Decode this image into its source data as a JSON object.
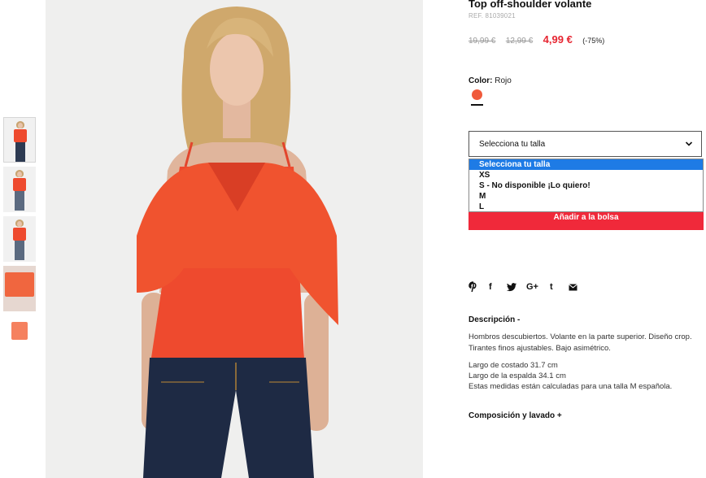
{
  "product": {
    "title": "Top off-shoulder volante",
    "ref": "REF. 81039021",
    "price_original": "19,99 €",
    "price_previous": "12,99 €",
    "price_current": "4,99 €",
    "discount": "(-75%)"
  },
  "color": {
    "label": "Color:",
    "value": "Rojo",
    "swatch_color": "#f05a3b"
  },
  "size": {
    "select_label": "Selecciona tu talla",
    "options": [
      "Selecciona tu talla",
      "XS",
      "S - No disponible ¡Lo quiero!",
      "M",
      "L"
    ]
  },
  "add_to_bag": "Añadir a la bolsa",
  "share_icons": [
    "pinterest-icon",
    "facebook-icon",
    "twitter-icon",
    "google-plus-icon",
    "tumblr-icon",
    "email-icon"
  ],
  "share_glyphs": {
    "facebook": "f",
    "google_plus": "G+",
    "tumblr": "t"
  },
  "description": {
    "title": "Descripción -",
    "text": "Hombros descubiertos. Volante en la parte superior. Diseño crop. Tirantes finos ajustables. Bajo asimétrico.",
    "measure_1": "Largo de costado 31.7 cm",
    "measure_2": "Largo de la espalda 34.1 cm",
    "measure_3": "Estas medidas están calculadas para una talla M española."
  },
  "composition_title": "Composición y lavado +",
  "colors": {
    "accent_red": "#e62531",
    "button_red": "#f0293a",
    "selected_blue": "#1e7be5"
  }
}
